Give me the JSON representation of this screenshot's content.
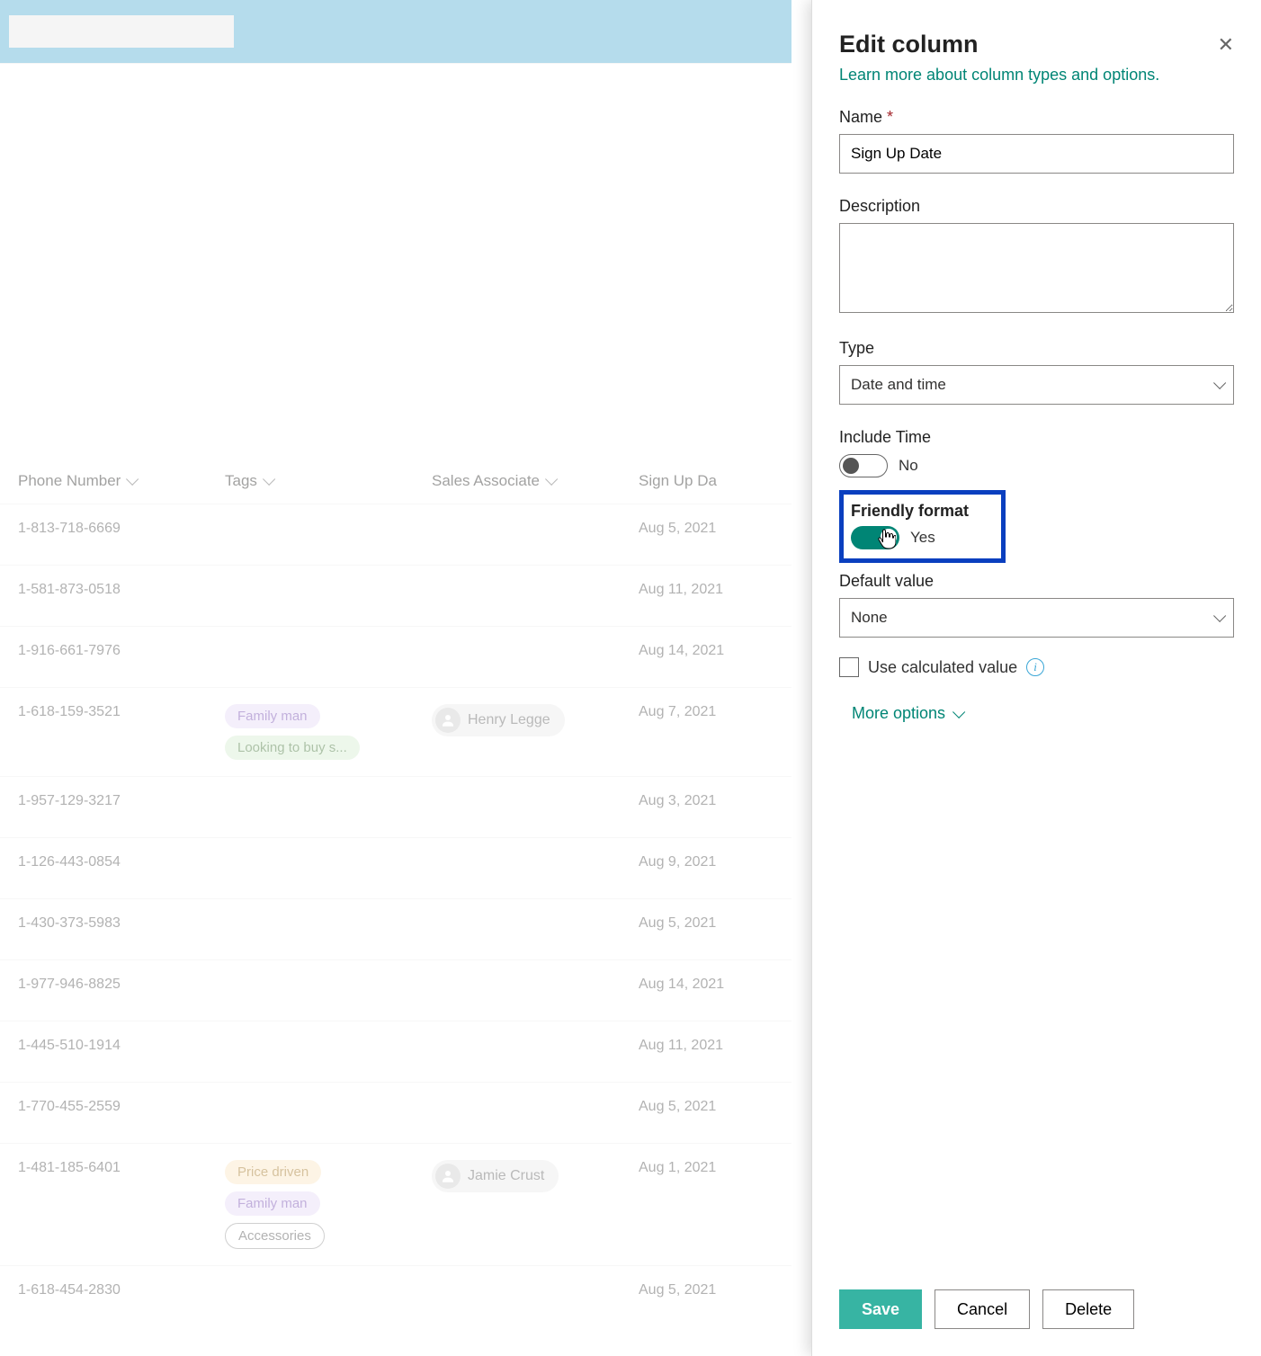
{
  "table": {
    "headers": {
      "phone": "Phone Number",
      "tags": "Tags",
      "assoc": "Sales Associate",
      "date": "Sign Up Da"
    },
    "rows": [
      {
        "phone": "1-813-718-6669",
        "tags": [],
        "assoc": "",
        "date": "Aug 5, 2021"
      },
      {
        "phone": "1-581-873-0518",
        "tags": [],
        "assoc": "",
        "date": "Aug 11, 2021"
      },
      {
        "phone": "1-916-661-7976",
        "tags": [],
        "assoc": "",
        "date": "Aug 14, 2021"
      },
      {
        "phone": "1-618-159-3521",
        "tags": [
          {
            "text": "Family man",
            "cls": "tag-purple"
          },
          {
            "text": "Looking to buy s...",
            "cls": "tag-green"
          }
        ],
        "assoc": "Henry Legge",
        "date": "Aug 7, 2021"
      },
      {
        "phone": "1-957-129-3217",
        "tags": [],
        "assoc": "",
        "date": "Aug 3, 2021"
      },
      {
        "phone": "1-126-443-0854",
        "tags": [],
        "assoc": "",
        "date": "Aug 9, 2021"
      },
      {
        "phone": "1-430-373-5983",
        "tags": [],
        "assoc": "",
        "date": "Aug 5, 2021"
      },
      {
        "phone": "1-977-946-8825",
        "tags": [],
        "assoc": "",
        "date": "Aug 14, 2021"
      },
      {
        "phone": "1-445-510-1914",
        "tags": [],
        "assoc": "",
        "date": "Aug 11, 2021"
      },
      {
        "phone": "1-770-455-2559",
        "tags": [],
        "assoc": "",
        "date": "Aug 5, 2021"
      },
      {
        "phone": "1-481-185-6401",
        "tags": [
          {
            "text": "Price driven",
            "cls": "tag-yellow"
          },
          {
            "text": "Family man",
            "cls": "tag-purple"
          },
          {
            "text": "Accessories",
            "cls": "tag-outline"
          }
        ],
        "assoc": "Jamie Crust",
        "date": "Aug 1, 2021"
      },
      {
        "phone": "1-618-454-2830",
        "tags": [],
        "assoc": "",
        "date": "Aug 5, 2021"
      }
    ]
  },
  "panel": {
    "title": "Edit column",
    "learn_more": "Learn more about column types and options.",
    "name_label": "Name",
    "name_value": "Sign Up Date",
    "desc_label": "Description",
    "desc_value": "",
    "type_label": "Type",
    "type_value": "Date and time",
    "include_time_label": "Include Time",
    "include_time_value": "No",
    "friendly_label": "Friendly format",
    "friendly_value": "Yes",
    "default_label": "Default value",
    "default_value": "None",
    "calc_label": "Use calculated value",
    "more_options": "More options",
    "save": "Save",
    "cancel": "Cancel",
    "delete": "Delete"
  }
}
